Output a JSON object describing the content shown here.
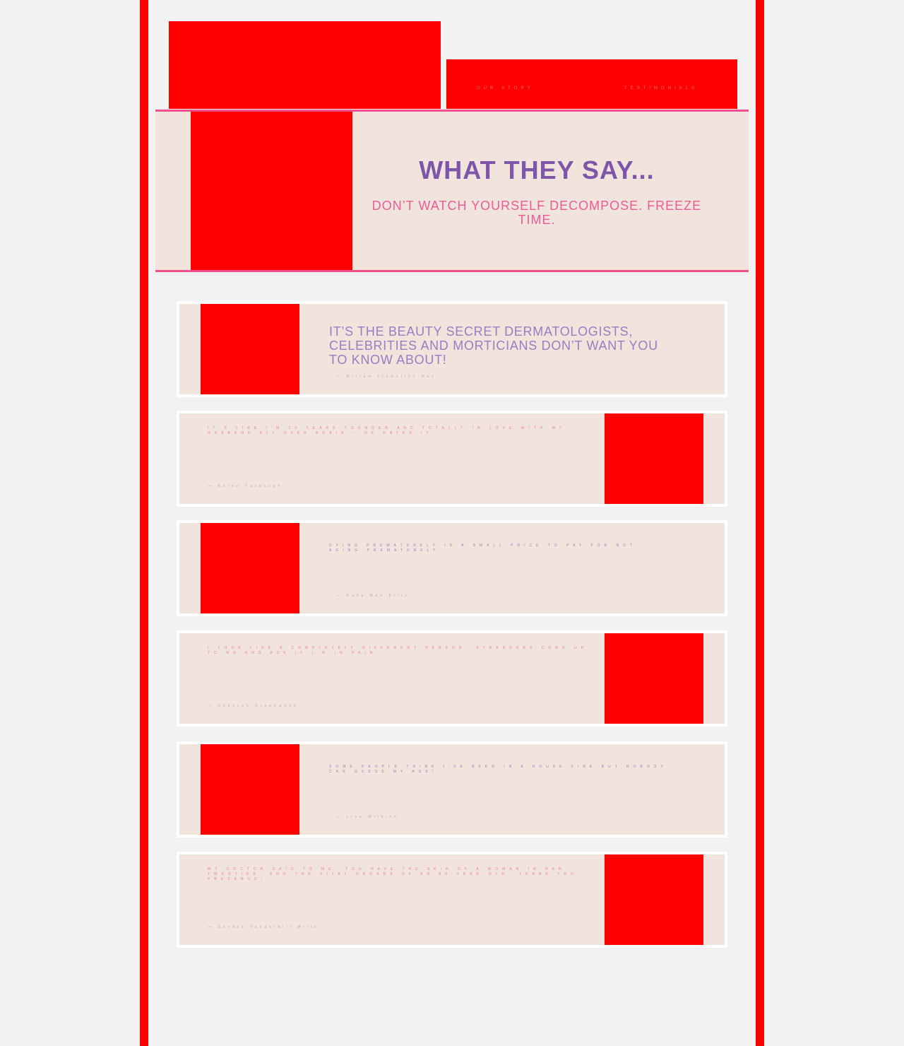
{
  "nav": {
    "links": [
      "Our Story",
      "Testimonials"
    ]
  },
  "hero": {
    "title": "WHAT THEY SAY...",
    "subtitle": "DON’T WATCH YOURSELF DECOMPOSE. FREEZE TIME."
  },
  "testimonials": [
    {
      "quote": "IT’S THE BEAUTY SECRET DERMATOLOGISTS, CELEBRITIES AND MORTICIANS DON’T WANT YOU TO KNOW ABOUT!",
      "author": "— Miriam Llewellyn-Hay"
    },
    {
      "quote": "It’s like I’m 20 years younger and totally in love with my husband all over again – he hates it",
      "author": "— Karen Yarbough"
    },
    {
      "quote": "Dying prematurely is a small price to pay for not aging prematurely",
      "author": "— Ruby Mae Ellis"
    },
    {
      "quote": "I look like a completely different person. Strangers come up to me and ask if I'm in pain",
      "author": "— Deborah Greenwood"
    },
    {
      "quote": "Some people think I've been in a house fire but nobody can guess my age!",
      "author": "— Lisa Wilkins"
    },
    {
      "quote": "My doctor said to me 'You have the skin of a woman in her twenties' and the vital organs of an 80-year-old, thank you Preservo!",
      "author": "— Sandra Vanderbilt Mills"
    }
  ]
}
